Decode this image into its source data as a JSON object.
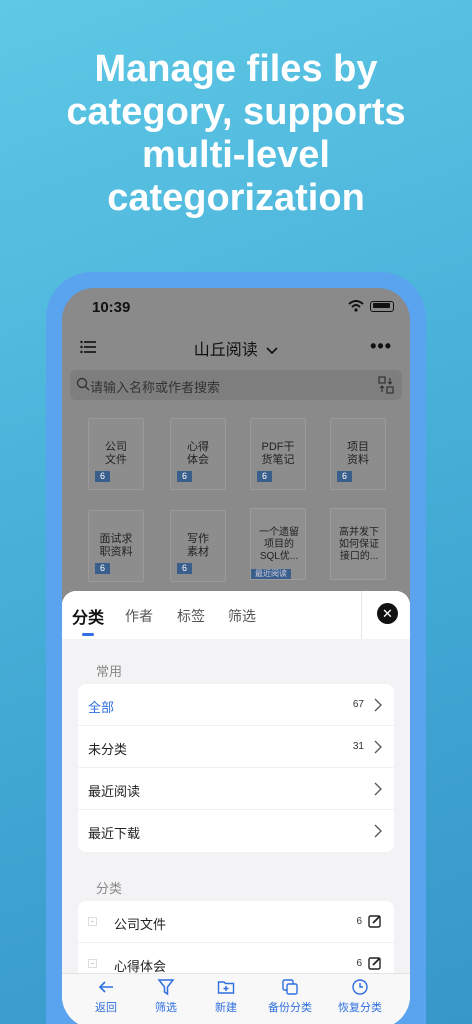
{
  "headline": "Manage files by category, supports multi-level categorization",
  "status_bar": {
    "time": "10:39"
  },
  "app": {
    "title": "山丘阅读",
    "search_placeholder": "请输入名称或作者搜索",
    "folders": [
      {
        "name": "公司\n文件",
        "count": "6"
      },
      {
        "name": "心得\n体会",
        "count": "6"
      },
      {
        "name": "PDF干\n货笔记",
        "count": "6"
      },
      {
        "name": "项目\n资料",
        "count": "6"
      },
      {
        "name": "面试求\n职资料",
        "count": "6"
      },
      {
        "name": "写作\n素材",
        "count": "6"
      }
    ],
    "docs": [
      {
        "name": "一个遗留\n项目的\nSQL优...",
        "tag": "最近阅读"
      },
      {
        "name": "高并发下\n如何保证\n接口的..."
      }
    ]
  },
  "sheet": {
    "tabs": [
      "分类",
      "作者",
      "标签",
      "筛选"
    ],
    "section_common": "常用",
    "common_items": [
      {
        "label": "全部",
        "count": "67"
      },
      {
        "label": "未分类",
        "count": "31"
      },
      {
        "label": "最近阅读",
        "count": ""
      },
      {
        "label": "最近下载",
        "count": ""
      }
    ],
    "section_categories": "分类",
    "category_items": [
      {
        "label": "公司文件",
        "count": "6"
      },
      {
        "label": "心得体会",
        "count": "6"
      }
    ]
  },
  "toolbar": {
    "back": "返回",
    "filter": "筛选",
    "new": "新建",
    "backup": "备份分类",
    "restore": "恢复分类"
  },
  "colors": {
    "accent": "#2f6fe0",
    "frame": "#5aa3ef"
  }
}
